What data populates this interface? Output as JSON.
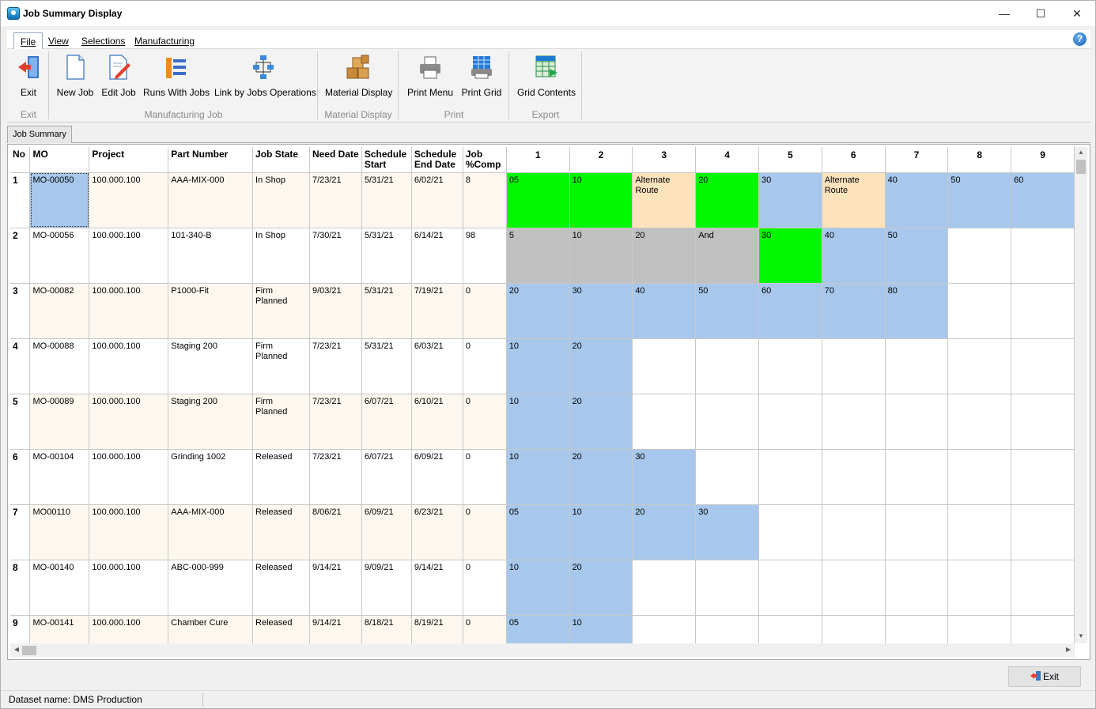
{
  "window": {
    "title": "Job Summary Display",
    "controls": {
      "minimize": "—",
      "maximize": "☐",
      "close": "✕"
    }
  },
  "menu": {
    "items": [
      "File",
      "View",
      "Selections",
      "Manufacturing"
    ],
    "active": "File",
    "help_icon": "?"
  },
  "ribbon": {
    "buttons": {
      "exit": "Exit",
      "new_job": "New Job",
      "edit_job": "Edit Job",
      "runs_with_jobs": "Runs With Jobs",
      "link_by_jobs_operations": "Link by Jobs Operations",
      "material_display": "Material Display",
      "print_menu": "Print Menu",
      "print_grid": "Print Grid",
      "grid_contents": "Grid Contents"
    },
    "groups": {
      "exit": "Exit",
      "manufacturing_job": "Manufacturing Job",
      "material_display": "Material Display",
      "print": "Print",
      "export": "Export"
    }
  },
  "tabs": {
    "job_summary": "Job Summary"
  },
  "colors": {
    "green": "#00f700",
    "blue": "#a7c8ec",
    "gray": "#c0c0c0",
    "orange": "#fde3bc",
    "white": "#ffffff"
  },
  "grid": {
    "columns": [
      "No",
      "MO",
      "Project",
      "Part Number",
      "Job State",
      "Need Date",
      "Schedule Start",
      "Schedule End Date",
      "Job %Comp",
      "1",
      "2",
      "3",
      "4",
      "5",
      "6",
      "7",
      "8",
      "9"
    ],
    "rows": [
      {
        "no": "1",
        "mo": "MO-00050",
        "project": "100.000.100",
        "part": "AAA-MIX-000",
        "state": "In Shop",
        "need": "7/23/21",
        "start": "5/31/21",
        "end": "6/02/21",
        "comp": "8",
        "ops": [
          {
            "t": "05",
            "c": "green"
          },
          {
            "t": "10",
            "c": "green"
          },
          {
            "t": "Alternate Route",
            "c": "orange"
          },
          {
            "t": "20",
            "c": "green"
          },
          {
            "t": "30",
            "c": "blue"
          },
          {
            "t": "Alternate Route",
            "c": "orange"
          },
          {
            "t": "40",
            "c": "blue"
          },
          {
            "t": "50",
            "c": "blue"
          },
          {
            "t": "60",
            "c": "blue"
          }
        ]
      },
      {
        "no": "2",
        "mo": "MO-00056",
        "project": "100.000.100",
        "part": "101-340-B",
        "state": "In Shop",
        "need": "7/30/21",
        "start": "5/31/21",
        "end": "6/14/21",
        "comp": "98",
        "ops": [
          {
            "t": "5",
            "c": "gray"
          },
          {
            "t": "10",
            "c": "gray"
          },
          {
            "t": "20",
            "c": "gray"
          },
          {
            "t": "And",
            "c": "gray"
          },
          {
            "t": "30",
            "c": "green"
          },
          {
            "t": "40",
            "c": "blue"
          },
          {
            "t": "50",
            "c": "blue"
          },
          {
            "t": "",
            "c": "white"
          },
          {
            "t": "",
            "c": "white"
          }
        ]
      },
      {
        "no": "3",
        "mo": "MO-00082",
        "project": "100.000.100",
        "part": "P1000-Fit",
        "state": "Firm Planned",
        "need": "9/03/21",
        "start": "5/31/21",
        "end": "7/19/21",
        "comp": "0",
        "ops": [
          {
            "t": "20",
            "c": "blue"
          },
          {
            "t": "30",
            "c": "blue"
          },
          {
            "t": "40",
            "c": "blue"
          },
          {
            "t": "50",
            "c": "blue"
          },
          {
            "t": "60",
            "c": "blue"
          },
          {
            "t": "70",
            "c": "blue"
          },
          {
            "t": "80",
            "c": "blue"
          },
          {
            "t": "",
            "c": "white"
          },
          {
            "t": "",
            "c": "white"
          }
        ]
      },
      {
        "no": "4",
        "mo": "MO-00088",
        "project": "100.000.100",
        "part": "Staging 200",
        "state": "Firm Planned",
        "need": "7/23/21",
        "start": "5/31/21",
        "end": "6/03/21",
        "comp": "0",
        "ops": [
          {
            "t": "10",
            "c": "blue"
          },
          {
            "t": "20",
            "c": "blue"
          },
          {
            "t": "",
            "c": "white"
          },
          {
            "t": "",
            "c": "white"
          },
          {
            "t": "",
            "c": "white"
          },
          {
            "t": "",
            "c": "white"
          },
          {
            "t": "",
            "c": "white"
          },
          {
            "t": "",
            "c": "white"
          },
          {
            "t": "",
            "c": "white"
          }
        ]
      },
      {
        "no": "5",
        "mo": "MO-00089",
        "project": "100.000.100",
        "part": "Staging 200",
        "state": "Firm Planned",
        "need": "7/23/21",
        "start": "6/07/21",
        "end": "6/10/21",
        "comp": "0",
        "ops": [
          {
            "t": "10",
            "c": "blue"
          },
          {
            "t": "20",
            "c": "blue"
          },
          {
            "t": "",
            "c": "white"
          },
          {
            "t": "",
            "c": "white"
          },
          {
            "t": "",
            "c": "white"
          },
          {
            "t": "",
            "c": "white"
          },
          {
            "t": "",
            "c": "white"
          },
          {
            "t": "",
            "c": "white"
          },
          {
            "t": "",
            "c": "white"
          }
        ]
      },
      {
        "no": "6",
        "mo": "MO-00104",
        "project": "100.000.100",
        "part": "Grinding 1002",
        "state": "Released",
        "need": "7/23/21",
        "start": "6/07/21",
        "end": "6/09/21",
        "comp": "0",
        "ops": [
          {
            "t": "10",
            "c": "blue"
          },
          {
            "t": "20",
            "c": "blue"
          },
          {
            "t": "30",
            "c": "blue"
          },
          {
            "t": "",
            "c": "white"
          },
          {
            "t": "",
            "c": "white"
          },
          {
            "t": "",
            "c": "white"
          },
          {
            "t": "",
            "c": "white"
          },
          {
            "t": "",
            "c": "white"
          },
          {
            "t": "",
            "c": "white"
          }
        ]
      },
      {
        "no": "7",
        "mo": "MO00110",
        "project": "100.000.100",
        "part": "AAA-MIX-000",
        "state": "Released",
        "need": "8/06/21",
        "start": "6/09/21",
        "end": "6/23/21",
        "comp": "0",
        "ops": [
          {
            "t": "05",
            "c": "blue"
          },
          {
            "t": "10",
            "c": "blue"
          },
          {
            "t": "20",
            "c": "blue"
          },
          {
            "t": "30",
            "c": "blue"
          },
          {
            "t": "",
            "c": "white"
          },
          {
            "t": "",
            "c": "white"
          },
          {
            "t": "",
            "c": "white"
          },
          {
            "t": "",
            "c": "white"
          },
          {
            "t": "",
            "c": "white"
          }
        ]
      },
      {
        "no": "8",
        "mo": "MO-00140",
        "project": "100.000.100",
        "part": "ABC-000-999",
        "state": "Released",
        "need": "9/14/21",
        "start": "9/09/21",
        "end": "9/14/21",
        "comp": "0",
        "ops": [
          {
            "t": "10",
            "c": "blue"
          },
          {
            "t": "20",
            "c": "blue"
          },
          {
            "t": "",
            "c": "white"
          },
          {
            "t": "",
            "c": "white"
          },
          {
            "t": "",
            "c": "white"
          },
          {
            "t": "",
            "c": "white"
          },
          {
            "t": "",
            "c": "white"
          },
          {
            "t": "",
            "c": "white"
          },
          {
            "t": "",
            "c": "white"
          }
        ]
      },
      {
        "no": "9",
        "mo": "MO-00141",
        "project": "100.000.100",
        "part": "Chamber Cure",
        "state": "Released",
        "need": "9/14/21",
        "start": "8/18/21",
        "end": "8/19/21",
        "comp": "0",
        "ops": [
          {
            "t": "05",
            "c": "blue"
          },
          {
            "t": "10",
            "c": "blue"
          },
          {
            "t": "",
            "c": "white"
          },
          {
            "t": "",
            "c": "white"
          },
          {
            "t": "",
            "c": "white"
          },
          {
            "t": "",
            "c": "white"
          },
          {
            "t": "",
            "c": "white"
          },
          {
            "t": "",
            "c": "white"
          },
          {
            "t": "",
            "c": "white"
          }
        ]
      }
    ]
  },
  "footer": {
    "exit_button": "Exit",
    "status_text": "Dataset name:  DMS Production"
  }
}
